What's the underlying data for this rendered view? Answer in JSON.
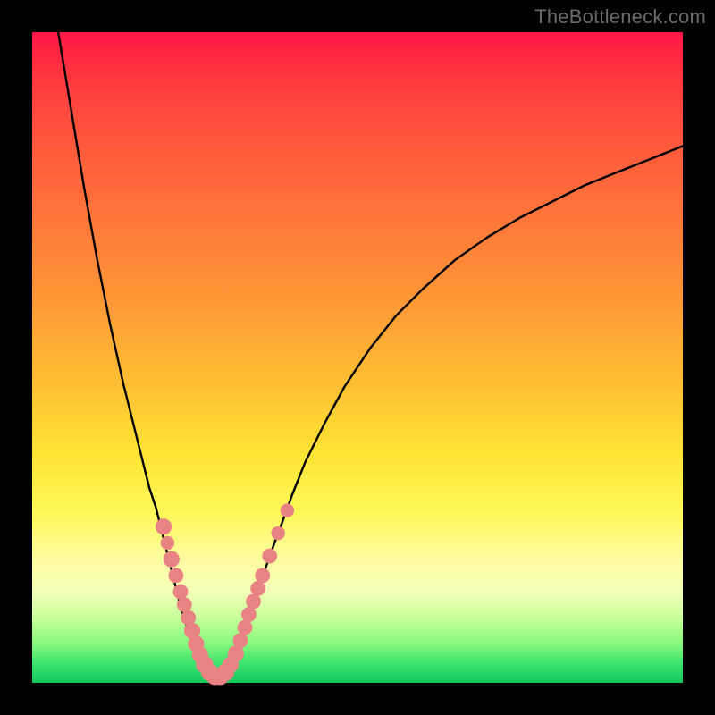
{
  "watermark": "TheBottleneck.com",
  "colors": {
    "frame": "#000000",
    "curve": "#000000",
    "marker_fill": "#e98383",
    "marker_stroke": "#d96d6d"
  },
  "chart_data": {
    "type": "line",
    "title": "",
    "xlabel": "",
    "ylabel": "",
    "xlim": [
      0,
      100
    ],
    "ylim": [
      0,
      100
    ],
    "grid": false,
    "curve_points": [
      {
        "x": 4.0,
        "y": 100.0
      },
      {
        "x": 5.0,
        "y": 94.0
      },
      {
        "x": 6.5,
        "y": 85.0
      },
      {
        "x": 8.0,
        "y": 76.0
      },
      {
        "x": 10.0,
        "y": 65.0
      },
      {
        "x": 12.0,
        "y": 55.0
      },
      {
        "x": 14.0,
        "y": 46.0
      },
      {
        "x": 16.0,
        "y": 38.0
      },
      {
        "x": 18.0,
        "y": 30.0
      },
      {
        "x": 19.0,
        "y": 27.0
      },
      {
        "x": 20.0,
        "y": 23.0
      },
      {
        "x": 21.0,
        "y": 19.0
      },
      {
        "x": 22.0,
        "y": 15.0
      },
      {
        "x": 23.0,
        "y": 11.0
      },
      {
        "x": 24.0,
        "y": 8.0
      },
      {
        "x": 25.0,
        "y": 5.0
      },
      {
        "x": 26.0,
        "y": 3.0
      },
      {
        "x": 27.0,
        "y": 1.5
      },
      {
        "x": 28.0,
        "y": 0.6
      },
      {
        "x": 29.0,
        "y": 0.6
      },
      {
        "x": 30.0,
        "y": 1.5
      },
      {
        "x": 31.0,
        "y": 3.5
      },
      {
        "x": 32.0,
        "y": 6.0
      },
      {
        "x": 33.0,
        "y": 9.0
      },
      {
        "x": 34.0,
        "y": 12.0
      },
      {
        "x": 35.0,
        "y": 15.0
      },
      {
        "x": 36.5,
        "y": 19.5
      },
      {
        "x": 38.0,
        "y": 23.5
      },
      {
        "x": 40.0,
        "y": 29.0
      },
      {
        "x": 42.0,
        "y": 34.0
      },
      {
        "x": 45.0,
        "y": 40.0
      },
      {
        "x": 48.0,
        "y": 45.5
      },
      {
        "x": 52.0,
        "y": 51.5
      },
      {
        "x": 56.0,
        "y": 56.5
      },
      {
        "x": 60.0,
        "y": 60.5
      },
      {
        "x": 65.0,
        "y": 65.0
      },
      {
        "x": 70.0,
        "y": 68.5
      },
      {
        "x": 75.0,
        "y": 71.5
      },
      {
        "x": 80.0,
        "y": 74.0
      },
      {
        "x": 85.0,
        "y": 76.5
      },
      {
        "x": 90.0,
        "y": 78.5
      },
      {
        "x": 95.0,
        "y": 80.5
      },
      {
        "x": 100.0,
        "y": 82.5
      }
    ],
    "markers": [
      {
        "x": 20.2,
        "y": 24.0,
        "r": 1.3
      },
      {
        "x": 20.8,
        "y": 21.5,
        "r": 1.1
      },
      {
        "x": 21.4,
        "y": 19.0,
        "r": 1.3
      },
      {
        "x": 22.1,
        "y": 16.5,
        "r": 1.2
      },
      {
        "x": 22.8,
        "y": 14.0,
        "r": 1.2
      },
      {
        "x": 23.4,
        "y": 12.0,
        "r": 1.2
      },
      {
        "x": 24.0,
        "y": 10.0,
        "r": 1.2
      },
      {
        "x": 24.6,
        "y": 8.0,
        "r": 1.3
      },
      {
        "x": 25.2,
        "y": 6.0,
        "r": 1.3
      },
      {
        "x": 25.8,
        "y": 4.3,
        "r": 1.3
      },
      {
        "x": 26.5,
        "y": 2.8,
        "r": 1.4
      },
      {
        "x": 27.3,
        "y": 1.6,
        "r": 1.4
      },
      {
        "x": 28.1,
        "y": 1.0,
        "r": 1.4
      },
      {
        "x": 28.9,
        "y": 1.0,
        "r": 1.4
      },
      {
        "x": 29.7,
        "y": 1.6,
        "r": 1.4
      },
      {
        "x": 30.5,
        "y": 2.8,
        "r": 1.3
      },
      {
        "x": 31.3,
        "y": 4.5,
        "r": 1.3
      },
      {
        "x": 32.0,
        "y": 6.5,
        "r": 1.2
      },
      {
        "x": 32.7,
        "y": 8.5,
        "r": 1.2
      },
      {
        "x": 33.3,
        "y": 10.5,
        "r": 1.2
      },
      {
        "x": 34.0,
        "y": 12.5,
        "r": 1.2
      },
      {
        "x": 34.7,
        "y": 14.5,
        "r": 1.2
      },
      {
        "x": 35.4,
        "y": 16.5,
        "r": 1.2
      },
      {
        "x": 36.5,
        "y": 19.5,
        "r": 1.2
      },
      {
        "x": 37.8,
        "y": 23.0,
        "r": 1.1
      },
      {
        "x": 39.2,
        "y": 26.5,
        "r": 1.1
      }
    ]
  }
}
